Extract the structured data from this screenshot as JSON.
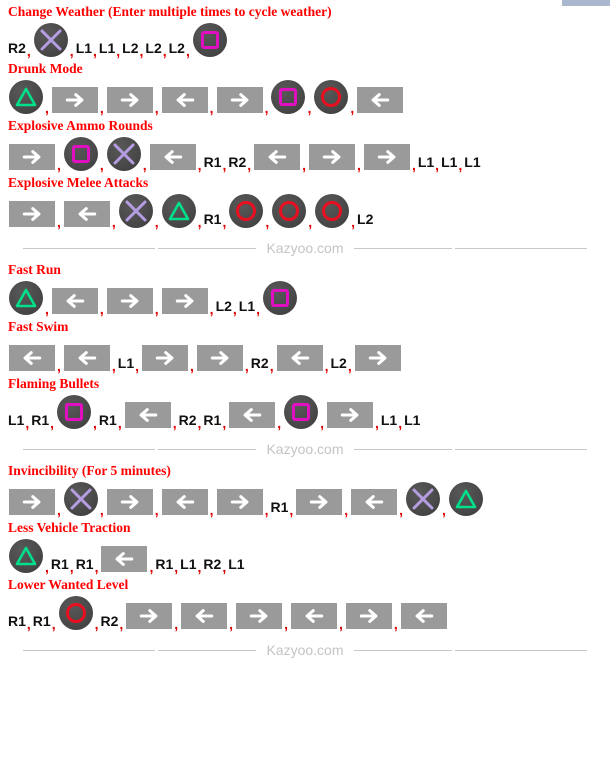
{
  "page": {
    "divider_label": "Kazyoo.com",
    "colors": {
      "heading": "#ff0000",
      "comma": "#e00000",
      "button_body": "#4a4a4a",
      "arrow_button": "#9a9a9a",
      "cross": "#b49de0",
      "square": "#e010c0",
      "triangle": "#00e08a",
      "circle": "#e81020",
      "divider_text": "#c4c4c4"
    }
  },
  "cheats": [
    {
      "title": "Change Weather (Enter multiple times to cycle weather)",
      "sequence": [
        {
          "type": "text",
          "label": "R2"
        },
        {
          "type": "button",
          "icon": "cross-button-icon",
          "label": "Cross"
        },
        {
          "type": "text",
          "label": "L1"
        },
        {
          "type": "text",
          "label": "L1"
        },
        {
          "type": "text",
          "label": "L2"
        },
        {
          "type": "text",
          "label": "L2"
        },
        {
          "type": "text",
          "label": "L2"
        },
        {
          "type": "button",
          "icon": "square-button-icon",
          "label": "Square"
        }
      ]
    },
    {
      "title": "Drunk Mode",
      "sequence": [
        {
          "type": "button",
          "icon": "triangle-button-icon",
          "label": "Triangle"
        },
        {
          "type": "arrow",
          "icon": "arrow-right-icon",
          "label": "Right"
        },
        {
          "type": "arrow",
          "icon": "arrow-right-icon",
          "label": "Right"
        },
        {
          "type": "arrow",
          "icon": "arrow-left-icon",
          "label": "Left"
        },
        {
          "type": "arrow",
          "icon": "arrow-right-icon",
          "label": "Right"
        },
        {
          "type": "button",
          "icon": "square-button-icon",
          "label": "Square"
        },
        {
          "type": "button",
          "icon": "circle-button-icon",
          "label": "Circle"
        },
        {
          "type": "arrow",
          "icon": "arrow-left-icon",
          "label": "Left"
        }
      ]
    },
    {
      "title": "Explosive Ammo Rounds",
      "sequence": [
        {
          "type": "arrow",
          "icon": "arrow-right-icon",
          "label": "Right"
        },
        {
          "type": "button",
          "icon": "square-button-icon",
          "label": "Square"
        },
        {
          "type": "button",
          "icon": "cross-button-icon",
          "label": "Cross"
        },
        {
          "type": "arrow",
          "icon": "arrow-left-icon",
          "label": "Left"
        },
        {
          "type": "text",
          "label": "R1"
        },
        {
          "type": "text",
          "label": "R2"
        },
        {
          "type": "arrow",
          "icon": "arrow-left-icon",
          "label": "Left"
        },
        {
          "type": "arrow",
          "icon": "arrow-right-icon",
          "label": "Right"
        },
        {
          "type": "arrow",
          "icon": "arrow-right-icon",
          "label": "Right"
        },
        {
          "type": "text",
          "label": "L1"
        },
        {
          "type": "text",
          "label": "L1"
        },
        {
          "type": "text",
          "label": "L1"
        }
      ]
    },
    {
      "title": "Explosive Melee Attacks",
      "sequence": [
        {
          "type": "arrow",
          "icon": "arrow-right-icon",
          "label": "Right"
        },
        {
          "type": "arrow",
          "icon": "arrow-left-icon",
          "label": "Left"
        },
        {
          "type": "button",
          "icon": "cross-button-icon",
          "label": "Cross"
        },
        {
          "type": "button",
          "icon": "triangle-button-icon",
          "label": "Triangle"
        },
        {
          "type": "text",
          "label": "R1"
        },
        {
          "type": "button",
          "icon": "circle-button-icon",
          "label": "Circle"
        },
        {
          "type": "button",
          "icon": "circle-button-icon",
          "label": "Circle"
        },
        {
          "type": "button",
          "icon": "circle-button-icon",
          "label": "Circle"
        },
        {
          "type": "text",
          "label": "L2"
        }
      ]
    },
    {
      "title": "Fast Run",
      "sequence": [
        {
          "type": "button",
          "icon": "triangle-button-icon",
          "label": "Triangle"
        },
        {
          "type": "arrow",
          "icon": "arrow-left-icon",
          "label": "Left"
        },
        {
          "type": "arrow",
          "icon": "arrow-right-icon",
          "label": "Right"
        },
        {
          "type": "arrow",
          "icon": "arrow-right-icon",
          "label": "Right"
        },
        {
          "type": "text",
          "label": "L2"
        },
        {
          "type": "text",
          "label": "L1"
        },
        {
          "type": "button",
          "icon": "square-button-icon",
          "label": "Square"
        }
      ]
    },
    {
      "title": "Fast Swim",
      "sequence": [
        {
          "type": "arrow",
          "icon": "arrow-left-icon",
          "label": "Left"
        },
        {
          "type": "arrow",
          "icon": "arrow-left-icon",
          "label": "Left"
        },
        {
          "type": "text",
          "label": "L1"
        },
        {
          "type": "arrow",
          "icon": "arrow-right-icon",
          "label": "Right"
        },
        {
          "type": "arrow",
          "icon": "arrow-right-icon",
          "label": "Right"
        },
        {
          "type": "text",
          "label": "R2"
        },
        {
          "type": "arrow",
          "icon": "arrow-left-icon",
          "label": "Left"
        },
        {
          "type": "text",
          "label": "L2"
        },
        {
          "type": "arrow",
          "icon": "arrow-right-icon",
          "label": "Right"
        }
      ]
    },
    {
      "title": "Flaming Bullets",
      "sequence": [
        {
          "type": "text",
          "label": "L1"
        },
        {
          "type": "text",
          "label": "R1"
        },
        {
          "type": "button",
          "icon": "square-button-icon",
          "label": "Square"
        },
        {
          "type": "text",
          "label": "R1"
        },
        {
          "type": "arrow",
          "icon": "arrow-left-icon",
          "label": "Left"
        },
        {
          "type": "text",
          "label": "R2"
        },
        {
          "type": "text",
          "label": "R1"
        },
        {
          "type": "arrow",
          "icon": "arrow-left-icon",
          "label": "Left"
        },
        {
          "type": "button",
          "icon": "square-button-icon",
          "label": "Square"
        },
        {
          "type": "arrow",
          "icon": "arrow-right-icon",
          "label": "Right"
        },
        {
          "type": "text",
          "label": "L1"
        },
        {
          "type": "text",
          "label": "L1"
        }
      ]
    },
    {
      "title": "Invincibility (For 5 minutes)",
      "sequence": [
        {
          "type": "arrow",
          "icon": "arrow-right-icon",
          "label": "Right"
        },
        {
          "type": "button",
          "icon": "cross-button-icon",
          "label": "Cross"
        },
        {
          "type": "arrow",
          "icon": "arrow-right-icon",
          "label": "Right"
        },
        {
          "type": "arrow",
          "icon": "arrow-left-icon",
          "label": "Left"
        },
        {
          "type": "arrow",
          "icon": "arrow-right-icon",
          "label": "Right"
        },
        {
          "type": "text",
          "label": "R1"
        },
        {
          "type": "arrow",
          "icon": "arrow-right-icon",
          "label": "Right"
        },
        {
          "type": "arrow",
          "icon": "arrow-left-icon",
          "label": "Left"
        },
        {
          "type": "button",
          "icon": "cross-button-icon",
          "label": "Cross"
        },
        {
          "type": "button",
          "icon": "triangle-button-icon",
          "label": "Triangle"
        }
      ]
    },
    {
      "title": "Less Vehicle Traction",
      "sequence": [
        {
          "type": "button",
          "icon": "triangle-button-icon",
          "label": "Triangle"
        },
        {
          "type": "text",
          "label": "R1"
        },
        {
          "type": "text",
          "label": "R1"
        },
        {
          "type": "arrow",
          "icon": "arrow-left-icon",
          "label": "Left"
        },
        {
          "type": "text",
          "label": "R1"
        },
        {
          "type": "text",
          "label": "L1"
        },
        {
          "type": "text",
          "label": "R2"
        },
        {
          "type": "text",
          "label": "L1"
        }
      ]
    },
    {
      "title": "Lower Wanted Level",
      "sequence": [
        {
          "type": "text",
          "label": "R1"
        },
        {
          "type": "text",
          "label": "R1"
        },
        {
          "type": "button",
          "icon": "circle-button-icon",
          "label": "Circle"
        },
        {
          "type": "text",
          "label": "R2"
        },
        {
          "type": "arrow",
          "icon": "arrow-right-icon",
          "label": "Right"
        },
        {
          "type": "arrow",
          "icon": "arrow-left-icon",
          "label": "Left"
        },
        {
          "type": "arrow",
          "icon": "arrow-right-icon",
          "label": "Right"
        },
        {
          "type": "arrow",
          "icon": "arrow-left-icon",
          "label": "Left"
        },
        {
          "type": "arrow",
          "icon": "arrow-right-icon",
          "label": "Right"
        },
        {
          "type": "arrow",
          "icon": "arrow-left-icon",
          "label": "Left"
        }
      ]
    }
  ],
  "divider_after_indexes": [
    3,
    6,
    9
  ]
}
